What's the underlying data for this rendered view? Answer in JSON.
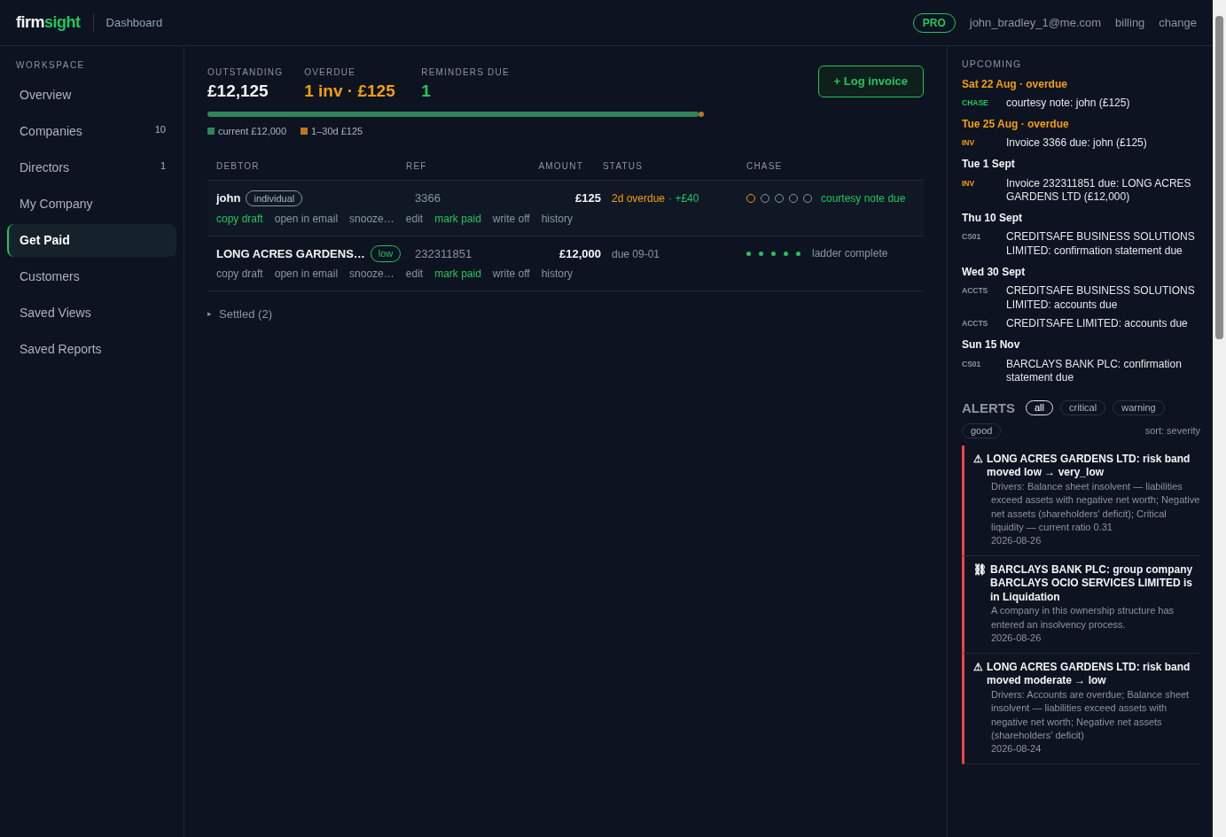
{
  "logo": {
    "first": "firm",
    "second": "sight"
  },
  "header": {
    "breadcrumb": "Dashboard",
    "plan": "PRO",
    "email": "john_bradley_1@me.com",
    "links": [
      "billing",
      "change"
    ]
  },
  "sidebar": {
    "section": "WORKSPACE",
    "items": [
      {
        "label": "Overview",
        "selected": false
      },
      {
        "label": "Companies",
        "count": "10",
        "selected": false
      },
      {
        "label": "Directors",
        "count": "1",
        "selected": false
      },
      {
        "label": "My Company",
        "selected": false
      },
      {
        "label": "Get Paid",
        "selected": true
      },
      {
        "label": "Customers",
        "selected": false
      },
      {
        "label": "Saved Views",
        "selected": false
      },
      {
        "label": "Saved Reports",
        "selected": false
      }
    ]
  },
  "summary": {
    "stats": [
      {
        "label": "OUTSTANDING",
        "value": "£12,125",
        "kind": "neutral"
      },
      {
        "label": "OVERDUE",
        "value": "1 inv · £125",
        "kind": "warning"
      },
      {
        "label": "REMINDERS DUE",
        "value": "1",
        "kind": "good"
      }
    ],
    "log_button": "+ Log invoice",
    "aging": [
      {
        "label": "current £12,000",
        "level": 0.99,
        "color": "#2f855a"
      },
      {
        "label": "1–30d £125",
        "level": 0.01,
        "color": "#b7791f"
      }
    ]
  },
  "table": {
    "columns": [
      "DEBTOR",
      "REF",
      "AMOUNT",
      "STATUS",
      "CHASE"
    ],
    "rows": [
      {
        "debtor": "john",
        "tag": "individual",
        "tag_highlighted": false,
        "ref": "3366",
        "amount": "£125",
        "status": "2d overdue",
        "overdue": true,
        "fee": "· +£40",
        "chase_steps": [
          {
            "done": false,
            "current": true
          },
          {
            "done": false,
            "current": false
          },
          {
            "done": false,
            "current": false
          },
          {
            "done": false,
            "current": false
          },
          {
            "done": false,
            "current": false
          }
        ],
        "chase_note": "courtesy note due",
        "note_due": true,
        "actions": [
          {
            "label": "copy draft",
            "highlighted": true
          },
          {
            "label": "open in email",
            "highlighted": false
          },
          {
            "label": "snooze…",
            "highlighted": false
          },
          {
            "label": "edit",
            "highlighted": false
          },
          {
            "label": "mark paid",
            "highlighted": true
          },
          {
            "label": "write off",
            "highlighted": false
          },
          {
            "label": "history",
            "highlighted": false
          }
        ]
      },
      {
        "debtor": "LONG ACRES GARDENS…",
        "tag": "low",
        "tag_highlighted": true,
        "ref": "232311851",
        "amount": "£12,000",
        "status": "due 09-01",
        "overdue": false,
        "chase_steps": [
          {
            "done": true,
            "current": false
          },
          {
            "done": true,
            "current": false
          },
          {
            "done": true,
            "current": false
          },
          {
            "done": true,
            "current": false
          },
          {
            "done": true,
            "current": false
          }
        ],
        "chase_note": "ladder complete",
        "note_due": false,
        "actions": [
          {
            "label": "copy draft",
            "highlighted": false
          },
          {
            "label": "open in email",
            "highlighted": false
          },
          {
            "label": "snooze…",
            "highlighted": false
          },
          {
            "label": "edit",
            "highlighted": false
          },
          {
            "label": "mark paid",
            "highlighted": true
          },
          {
            "label": "write off",
            "highlighted": false
          },
          {
            "label": "history",
            "highlighted": false
          }
        ]
      }
    ]
  },
  "settled": {
    "marker": "▸",
    "label": "Settled (2)",
    "expanded": false
  },
  "upcoming": {
    "title": "UPCOMING",
    "groups": [
      {
        "date": "Sat 22 Aug · overdue",
        "overdue": true,
        "items": [
          {
            "tag": "CHASE",
            "kind": "chase",
            "text": "courtesy note: john (£125)"
          }
        ]
      },
      {
        "date": "Tue 25 Aug · overdue",
        "overdue": true,
        "items": [
          {
            "tag": "INV",
            "kind": "invoice",
            "text": "Invoice 3366 due: john (£125)"
          }
        ]
      },
      {
        "date": "Tue 1 Sept",
        "overdue": false,
        "items": [
          {
            "tag": "INV",
            "kind": "invoice",
            "text": "Invoice 232311851 due: LONG ACRES GARDENS LTD (£12,000)"
          }
        ]
      },
      {
        "date": "Thu 10 Sept",
        "overdue": false,
        "items": [
          {
            "tag": "CS01",
            "kind": "filing",
            "text": "CREDITSAFE BUSINESS SOLUTIONS LIMITED: confirmation statement due"
          }
        ]
      },
      {
        "date": "Wed 30 Sept",
        "overdue": false,
        "items": [
          {
            "tag": "ACCTS",
            "kind": "filing",
            "text": "CREDITSAFE BUSINESS SOLUTIONS LIMITED: accounts due"
          },
          {
            "tag": "ACCTS",
            "kind": "filing",
            "text": "CREDITSAFE LIMITED: accounts due"
          }
        ]
      },
      {
        "date": "Sun 15 Nov",
        "overdue": false,
        "items": [
          {
            "tag": "CS01",
            "kind": "filing",
            "text": "BARCLAYS BANK PLC: confirmation statement due"
          }
        ]
      }
    ]
  },
  "alerts": {
    "title": "ALERTS",
    "filters": [
      {
        "label": "all",
        "selected": true
      },
      {
        "label": "critical",
        "selected": false
      },
      {
        "label": "warning",
        "selected": false
      },
      {
        "label": "good",
        "selected": false
      }
    ],
    "sort": "sort: severity",
    "items": [
      {
        "icon": "⚠",
        "title": "LONG ACRES GARDENS LTD: risk band moved low → very_low",
        "body": "Drivers: Balance sheet insolvent — liabilities exceed assets with negative net worth; Negative net assets (shareholders' deficit); Critical liquidity — current ratio 0.31",
        "date": "2026-08-26",
        "critical": true
      },
      {
        "icon": "⛓",
        "title": "BARCLAYS BANK PLC: group company BARCLAYS OCIO SERVICES LIMITED is in Liquidation",
        "body": "A company in this ownership structure has entered an insolvency process.",
        "date": "2026-08-26",
        "critical": true
      },
      {
        "icon": "⚠",
        "title": "LONG ACRES GARDENS LTD: risk band moved moderate → low",
        "body": "Drivers: Accounts are overdue; Balance sheet insolvent — liabilities exceed assets with negative net worth; Negative net assets (shareholders' deficit)",
        "date": "2026-08-24",
        "critical": true
      }
    ]
  }
}
